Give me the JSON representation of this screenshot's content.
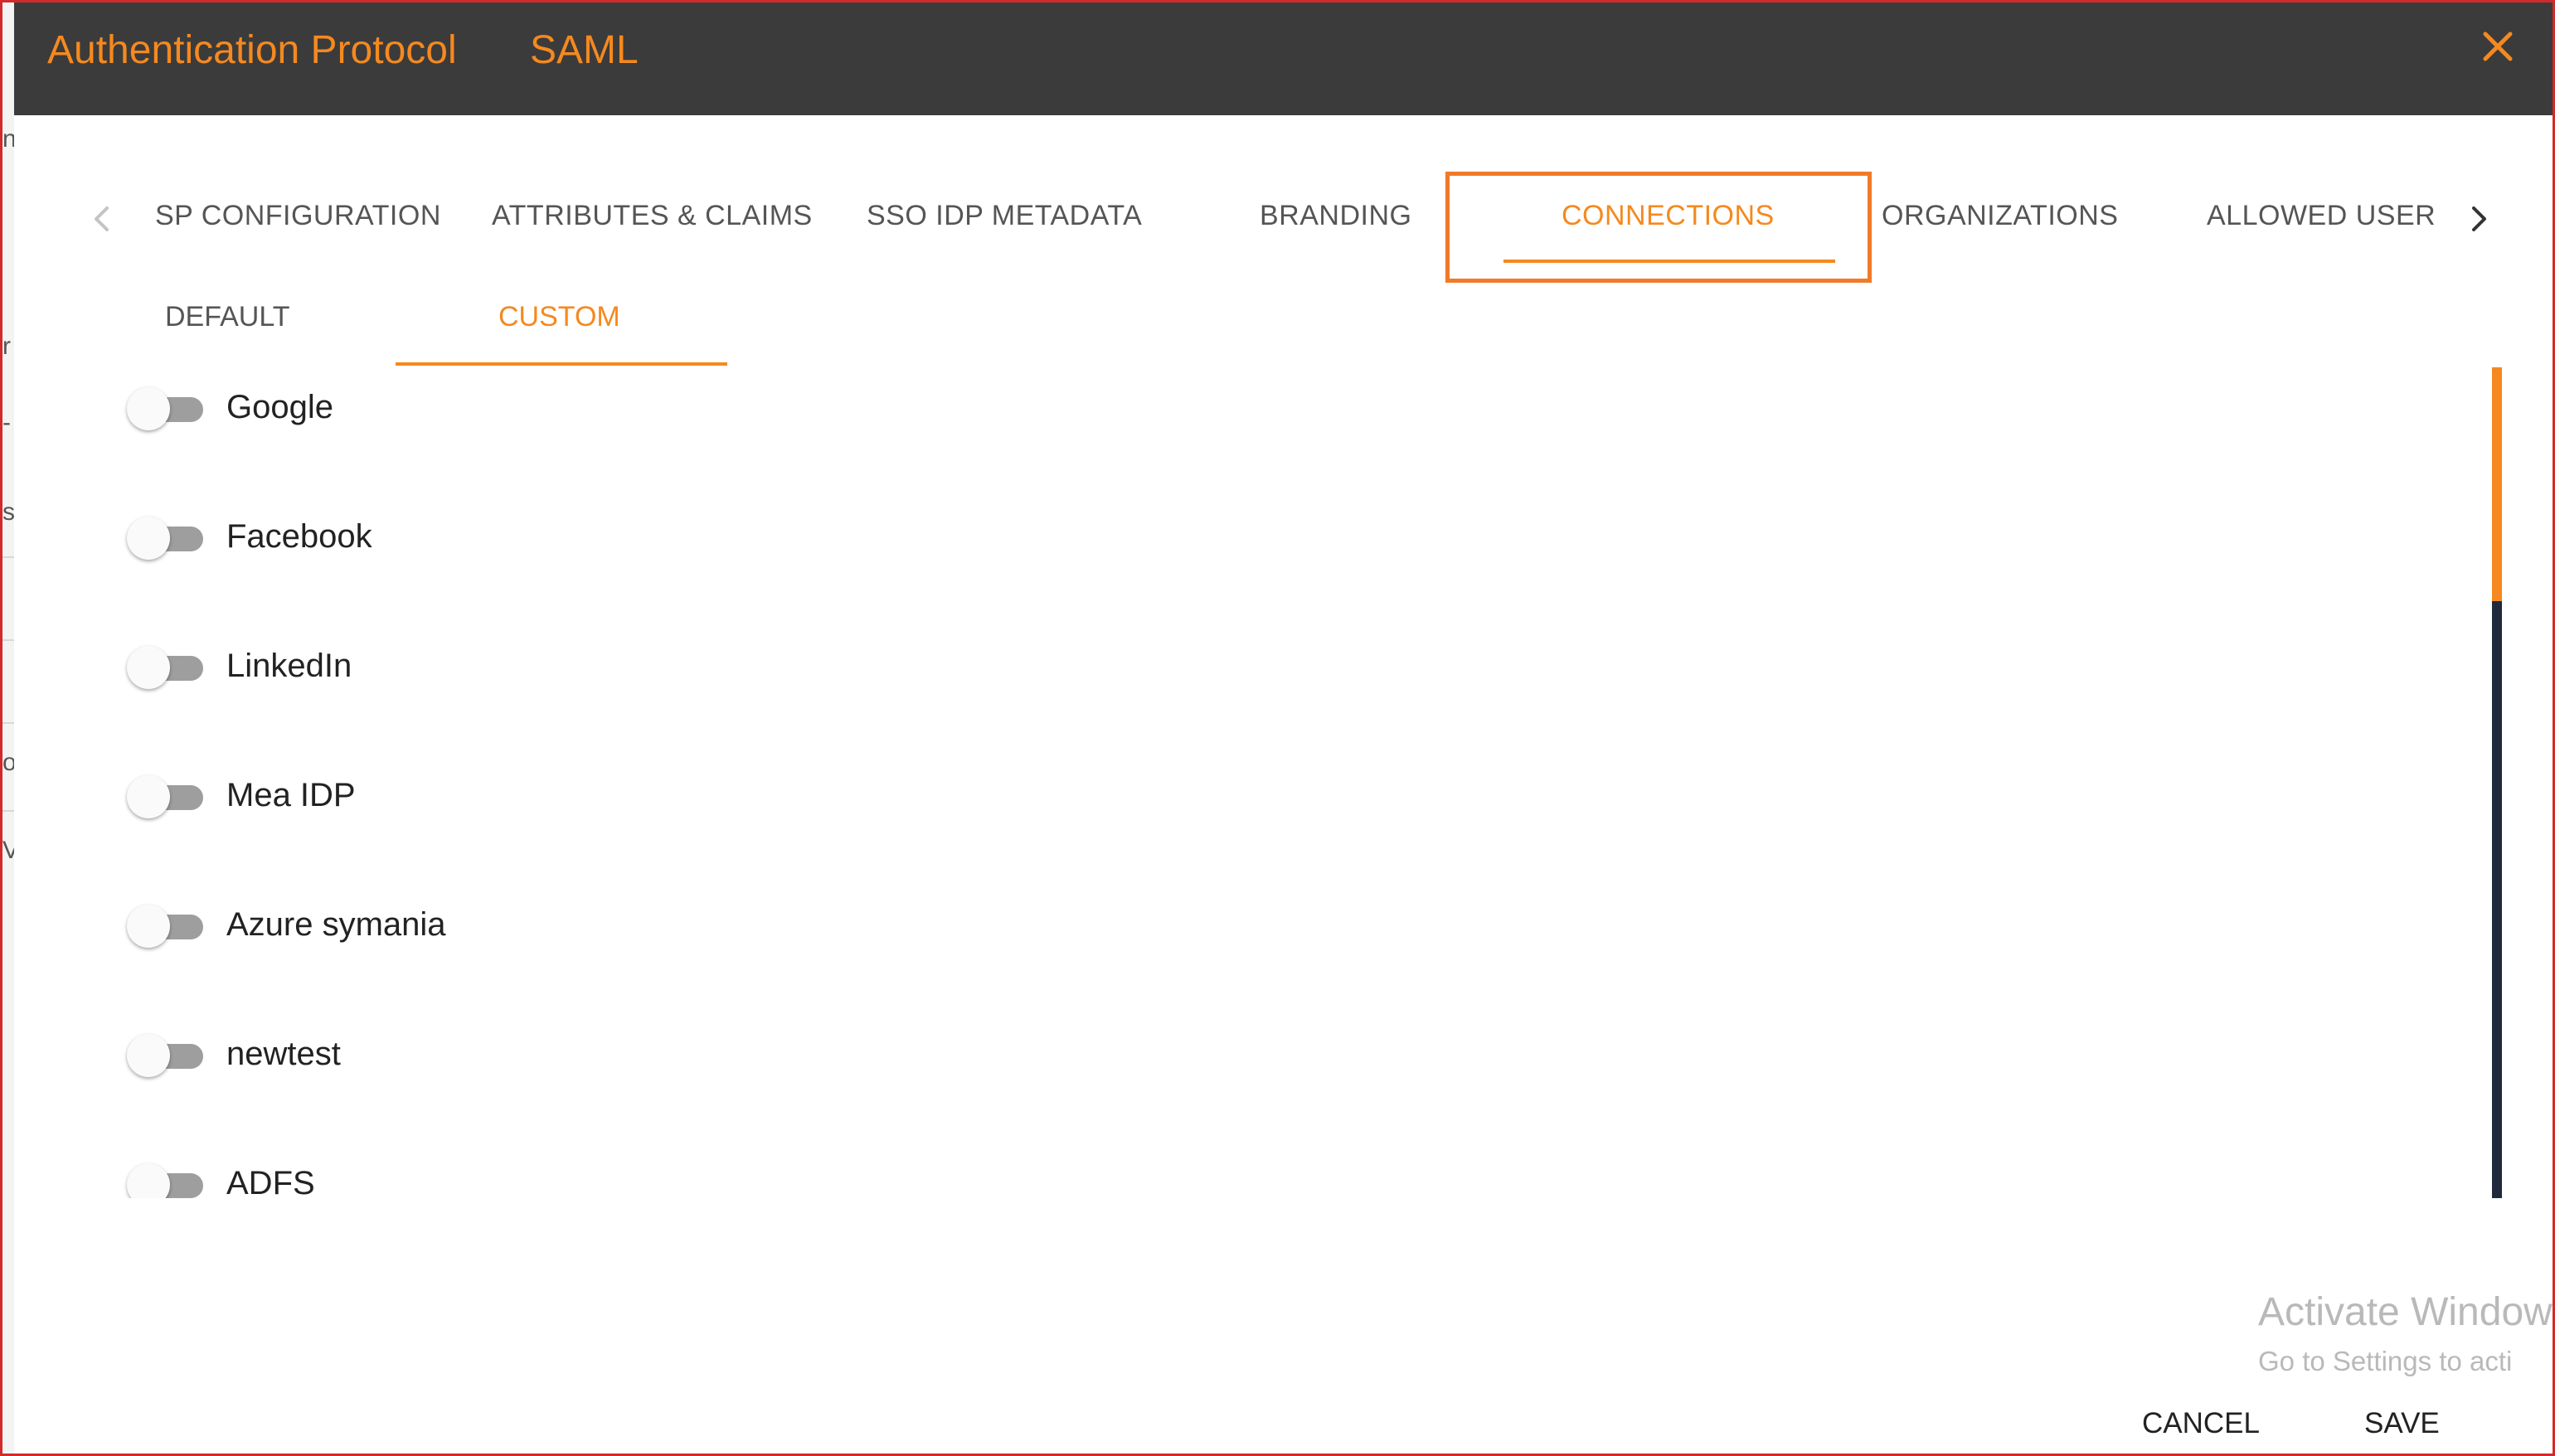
{
  "header": {
    "title": "Authentication Protocol",
    "subtitle": "SAML",
    "close_icon": "close-icon",
    "accent_color": "#f5891f",
    "background_color": "#3b3b3b"
  },
  "tabs": {
    "items": [
      {
        "label": "SP CONFIGURATION"
      },
      {
        "label": "ATTRIBUTES & CLAIMS"
      },
      {
        "label": "SSO IDP METADATA"
      },
      {
        "label": "BRANDING"
      },
      {
        "label": "CONNECTIONS"
      },
      {
        "label": "ORGANIZATIONS"
      },
      {
        "label": "ALLOWED USER"
      }
    ],
    "active": "CONNECTIONS",
    "prev_icon": "chevron-left-icon",
    "next_icon": "chevron-right-icon"
  },
  "subtabs": {
    "items": [
      {
        "label": "DEFAULT"
      },
      {
        "label": "CUSTOM"
      }
    ],
    "active": "CUSTOM"
  },
  "connections": [
    {
      "label": "Google",
      "enabled": false
    },
    {
      "label": "Facebook",
      "enabled": false
    },
    {
      "label": "LinkedIn",
      "enabled": false
    },
    {
      "label": "Mea IDP",
      "enabled": false
    },
    {
      "label": "Azure symania",
      "enabled": false
    },
    {
      "label": "newtest",
      "enabled": false
    },
    {
      "label": "ADFS",
      "enabled": false
    }
  ],
  "watermark": {
    "title": "Activate Window",
    "subtitle": "Go to Settings to acti"
  },
  "footer": {
    "cancel_label": "CANCEL",
    "save_label": "SAVE"
  },
  "background_fragments": [
    "n",
    "r",
    "-",
    "s",
    "o",
    "V"
  ]
}
